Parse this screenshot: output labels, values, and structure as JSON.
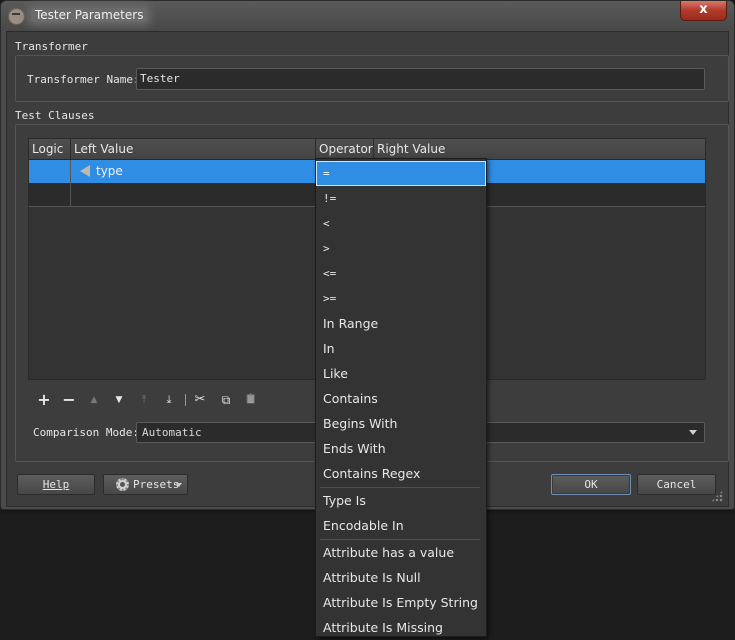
{
  "window": {
    "title": "Tester Parameters",
    "close_label": "x"
  },
  "transformer_group": {
    "label": "Transformer",
    "name_label": "Transformer Name:",
    "name_value": "Tester"
  },
  "test_clauses": {
    "label": "Test Clauses",
    "columns": [
      "Logic",
      "Left Value",
      "Operator",
      "Right Value"
    ],
    "rows": [
      {
        "logic": "",
        "left_value": "type",
        "operator": "=",
        "right_value": ""
      }
    ],
    "toolbar": {
      "add": "+",
      "remove": "−",
      "move_up": "▲",
      "move_down": "▼",
      "move_top": "⤒",
      "move_bottom": "⤓",
      "cut": "✂",
      "copy": "⧉",
      "paste": "📋"
    },
    "comparison_mode_label": "Comparison Mode:",
    "comparison_mode_value": "Automatic"
  },
  "footer": {
    "help_label": "Help",
    "presets_label": "Presets",
    "ok_label": "OK",
    "cancel_label": "Cancel"
  },
  "operator_dropdown": {
    "selected": "=",
    "options": [
      "=",
      "!=",
      "<",
      ">",
      "<=",
      ">=",
      "In Range",
      "In",
      "Like",
      "Contains",
      "Begins With",
      "Ends With",
      "Contains Regex",
      "Type Is",
      "Encodable In",
      "Attribute has a value",
      "Attribute Is Null",
      "Attribute Is Empty String",
      "Attribute Is Missing"
    ]
  },
  "colors": {
    "selection": "#2f8de4",
    "window_bg": "#3d3d3d",
    "close_button": "#b03a2a"
  }
}
